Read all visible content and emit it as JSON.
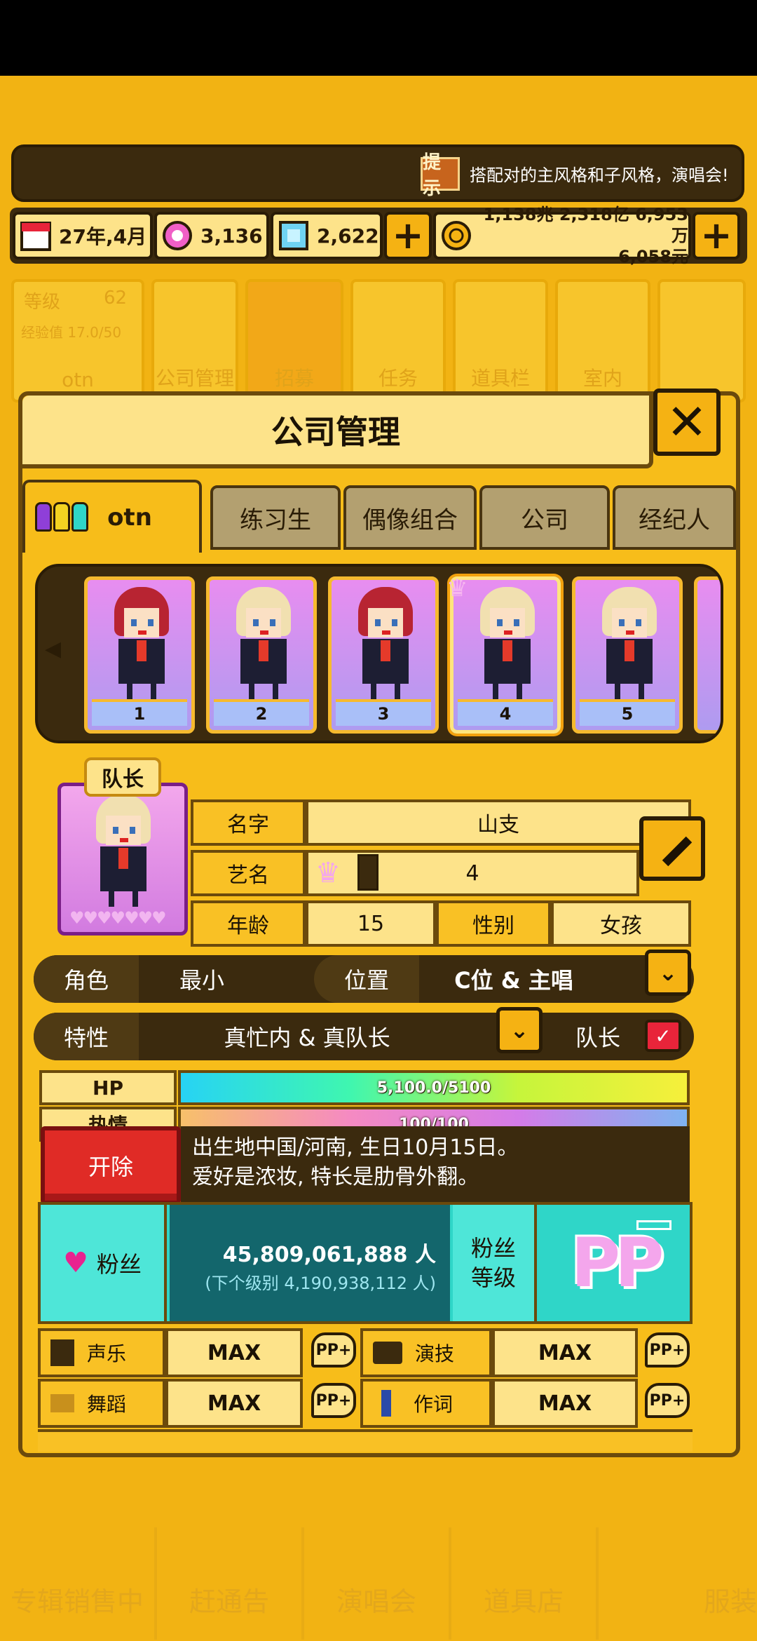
{
  "hint": {
    "icon_label": "提示",
    "text": "搭配对的主风格和子风格，演唱会!"
  },
  "resources": {
    "date": "27年,4月",
    "gems_pink": "3,136",
    "gems_blue": "2,622",
    "money_line1": "1,138兆 2,318亿 6,953万",
    "money_line2": "6,058元"
  },
  "background_menu": {
    "level_label": "等级",
    "level_value": "62",
    "exp_label": "经验值 17.0/50",
    "user": "otn",
    "items": [
      "公司管理",
      "招募",
      "任务",
      "道具栏",
      "室内"
    ],
    "bottom_items": [
      "专辑销售中",
      "赶通告",
      "演唱会",
      "道具店",
      "服装"
    ]
  },
  "panel": {
    "title": "公司管理",
    "tabs": [
      "otn",
      "练习生",
      "偶像组合",
      "公司",
      "经纪人"
    ],
    "cards": [
      "1",
      "2",
      "3",
      "4",
      "5"
    ],
    "selected_card": "4"
  },
  "profile": {
    "badge": "队长",
    "labels": {
      "name": "名字",
      "stage": "艺名",
      "age": "年龄",
      "gender": "性别"
    },
    "name": "山支",
    "stage_name": "4",
    "age": "15",
    "gender": "女孩",
    "role_label": "角色",
    "role_value": "最小",
    "position_label": "位置",
    "position_value": "C位 & 主唱",
    "trait_label": "特性",
    "trait_value": "真忙内 & 真队长",
    "leader_label": "队长"
  },
  "stats": {
    "hp_label": "HP",
    "hp_text": "5,100.0/5100",
    "hp_fraction": 1.0,
    "passion_label": "热情",
    "passion_text": "100/100",
    "passion_fraction": 1.0
  },
  "fire_button": "开除",
  "bio_line1": "出生地中国/河南, 生日10月15日。",
  "bio_line2": "爱好是浓妆, 特长是肋骨外翻。",
  "fans": {
    "label": "粉丝",
    "count": "45,809,061,888 人",
    "next": "(下个级别 4,190,938,112 人)",
    "level_label_1": "粉丝",
    "level_label_2": "等级",
    "rank": "PP"
  },
  "skills": [
    {
      "name": "声乐",
      "value": "MAX",
      "rank": "PP+"
    },
    {
      "name": "演技",
      "value": "MAX",
      "rank": "PP+"
    },
    {
      "name": "舞蹈",
      "value": "MAX",
      "rank": "PP+"
    },
    {
      "name": "作词",
      "value": "MAX",
      "rank": "PP+"
    }
  ],
  "colors": {
    "background": "#f2b313",
    "panel": "#f7bd1a",
    "dark": "#3b2a0e",
    "fire": "#e02b26",
    "fans": "#2fd6c8"
  }
}
